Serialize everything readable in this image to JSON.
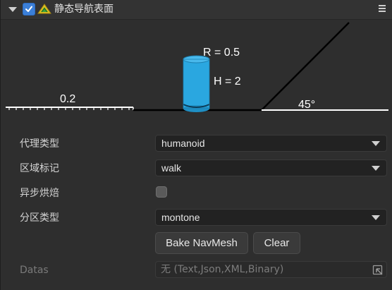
{
  "header": {
    "title": "静态导航表面",
    "enabled": true
  },
  "diagram": {
    "step_label": "0.2",
    "radius_label": "R = 0.5",
    "height_label": "H = 2",
    "slope_label": "45°",
    "colors": {
      "agent": "#2aa7e0",
      "ground": "#ffffff"
    }
  },
  "properties": {
    "agent_type": {
      "label": "代理类型",
      "value": "humanoid"
    },
    "area": {
      "label": "区域标记",
      "value": "walk"
    },
    "async_bake": {
      "label": "异步烘焙",
      "checked": false
    },
    "partition": {
      "label": "分区类型",
      "value": "montone"
    }
  },
  "buttons": {
    "bake": "Bake NavMesh",
    "clear": "Clear"
  },
  "datas": {
    "label": "Datas",
    "placeholder": "无 (Text,Json,XML,Binary)"
  },
  "icons": {
    "collapse": "chevron-down-icon",
    "checkbox": "checkmark-icon",
    "component": "navmesh-icon",
    "menu": "hamburger-menu-icon",
    "picker": "object-picker-icon"
  }
}
